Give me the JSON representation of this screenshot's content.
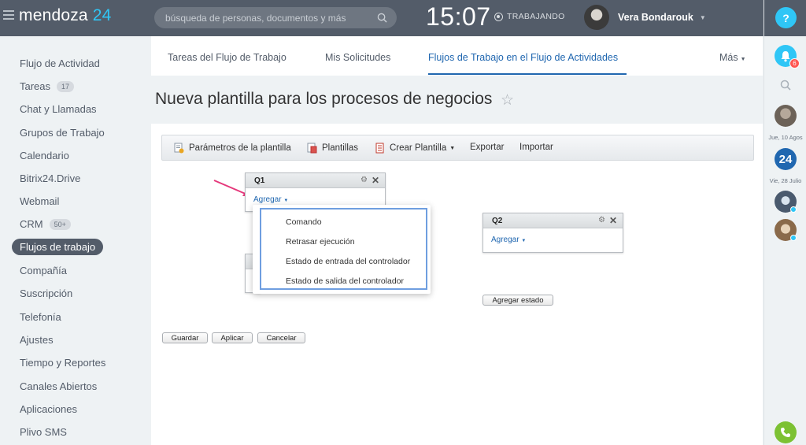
{
  "header": {
    "logo_text": "mendoza",
    "logo_number": "24",
    "search_placeholder": "búsqueda de personas, documentos y más",
    "clock": "15:07",
    "status": "TRABAJANDO",
    "user_name": "Vera Bondarouk"
  },
  "sidebar": {
    "items": [
      {
        "label": "Flujo de Actividad"
      },
      {
        "label": "Tareas",
        "badge": "17"
      },
      {
        "label": "Chat y Llamadas"
      },
      {
        "label": "Grupos de Trabajo"
      },
      {
        "label": "Calendario"
      },
      {
        "label": "Bitrix24.Drive"
      },
      {
        "label": "Webmail"
      },
      {
        "label": "CRM",
        "badge": "50+"
      },
      {
        "label": "Flujos de trabajo",
        "active": true
      },
      {
        "label": "Compañía"
      },
      {
        "label": "Suscripción"
      },
      {
        "label": "Telefonía"
      },
      {
        "label": "Ajustes"
      },
      {
        "label": "Tiempo y Reportes"
      },
      {
        "label": "Canales Abiertos"
      },
      {
        "label": "Aplicaciones"
      },
      {
        "label": "Plivo SMS"
      }
    ]
  },
  "tabs": {
    "items": [
      {
        "label": "Tareas del Flujo de Trabajo"
      },
      {
        "label": "Mis Solicitudes"
      },
      {
        "label": "Flujos de Trabajo en el Flujo de Actividades",
        "active": true
      },
      {
        "label": "Más"
      }
    ]
  },
  "page": {
    "title": "Nueva plantilla para los procesos de negocios"
  },
  "toolbar": {
    "params": "Parámetros de la plantilla",
    "templates": "Plantillas",
    "create": "Crear Plantilla",
    "export": "Exportar",
    "import": "Importar"
  },
  "states": {
    "q1": {
      "title": "Q1",
      "add": "Agregar"
    },
    "q2": {
      "title": "Q2",
      "add": "Agregar"
    }
  },
  "menu": {
    "items": [
      "Comando",
      "Retrasar ejecución",
      "Estado de entrada del controlador",
      "Estado de salida del controlador"
    ]
  },
  "buttons": {
    "add_state": "Agregar estado",
    "save": "Guardar",
    "apply": "Aplicar",
    "cancel": "Cancelar"
  },
  "rightbar": {
    "help": "?",
    "notifications": "6",
    "date1": "Jue, 10 Agos",
    "badge24": "24",
    "date2": "Vie, 28 Julio"
  },
  "colors": {
    "topbar": "#535c69",
    "accent": "#2fc6f6",
    "link": "#2067b0",
    "badge_red": "#ff5752",
    "phone_green": "#7cc133"
  }
}
